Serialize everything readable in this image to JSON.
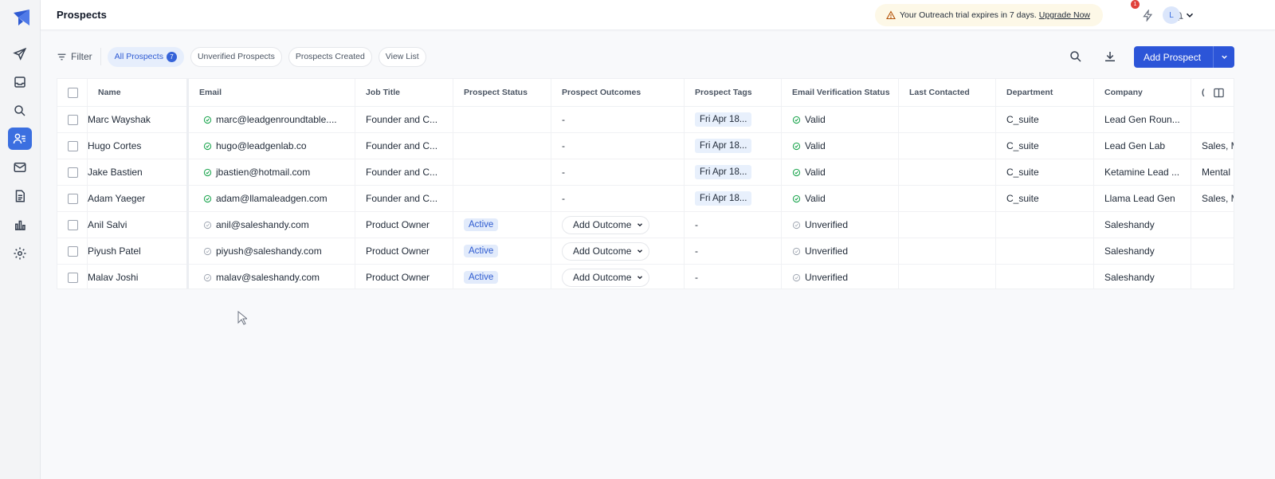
{
  "app": {
    "page_title": "Prospects"
  },
  "trial_banner": {
    "text": "Your Outreach trial expires in 7 days.",
    "link": "Upgrade Now"
  },
  "header": {
    "notification_count": "1",
    "avatar_initial": "L"
  },
  "filter_bar": {
    "filter_label": "Filter",
    "chips": [
      {
        "label": "All Prospects",
        "count": "7",
        "active": true
      },
      {
        "label": "Unverified Prospects"
      },
      {
        "label": "Prospects Created"
      },
      {
        "label": "View List"
      }
    ]
  },
  "actions": {
    "add_prospect_label": "Add Prospect"
  },
  "table": {
    "columns": [
      "Name",
      "Email",
      "Job Title",
      "Prospect Status",
      "Prospect Outcomes",
      "Prospect Tags",
      "Email Verification Status",
      "Last Contacted",
      "Department",
      "Company",
      "("
    ],
    "rows": [
      {
        "name": "Marc Wayshak",
        "email": "marc@leadgenroundtable....",
        "email_verified": true,
        "job_title": "Founder and C...",
        "status": "",
        "outcome": "-",
        "outcome_dropdown": false,
        "tags": "Fri Apr 18...",
        "verification": "Valid",
        "last_contacted": "",
        "department": "C_suite",
        "company": "Lead Gen Roun...",
        "extra": ""
      },
      {
        "name": "Hugo Cortes",
        "email": "hugo@leadgenlab.co",
        "email_verified": true,
        "job_title": "Founder and C...",
        "status": "",
        "outcome": "-",
        "outcome_dropdown": false,
        "tags": "Fri Apr 18...",
        "verification": "Valid",
        "last_contacted": "",
        "department": "C_suite",
        "company": "Lead Gen Lab",
        "extra": "Sales, M"
      },
      {
        "name": "Jake Bastien",
        "email": "jbastien@hotmail.com",
        "email_verified": true,
        "job_title": "Founder and C...",
        "status": "",
        "outcome": "-",
        "outcome_dropdown": false,
        "tags": "Fri Apr 18...",
        "verification": "Valid",
        "last_contacted": "",
        "department": "C_suite",
        "company": "Ketamine Lead ...",
        "extra": "Mental"
      },
      {
        "name": "Adam Yaeger",
        "email": "adam@llamaleadgen.com",
        "email_verified": true,
        "job_title": "Founder and C...",
        "status": "",
        "outcome": "-",
        "outcome_dropdown": false,
        "tags": "Fri Apr 18...",
        "verification": "Valid",
        "last_contacted": "",
        "department": "C_suite",
        "company": "Llama Lead Gen",
        "extra": "Sales, M"
      },
      {
        "name": "Anil Salvi",
        "email": "anil@saleshandy.com",
        "email_verified": false,
        "job_title": "Product Owner",
        "status": "Active",
        "outcome": "Add Outcome",
        "outcome_dropdown": true,
        "tags": "-",
        "verification": "Unverified",
        "last_contacted": "",
        "department": "",
        "company": "Saleshandy",
        "extra": ""
      },
      {
        "name": "Piyush Patel",
        "email": "piyush@saleshandy.com",
        "email_verified": false,
        "job_title": "Product Owner",
        "status": "Active",
        "outcome": "Add Outcome",
        "outcome_dropdown": true,
        "tags": "-",
        "verification": "Unverified",
        "last_contacted": "",
        "department": "",
        "company": "Saleshandy",
        "extra": ""
      },
      {
        "name": "Malav Joshi",
        "email": "malav@saleshandy.com",
        "email_verified": false,
        "job_title": "Product Owner",
        "status": "Active",
        "outcome": "Add Outcome",
        "outcome_dropdown": true,
        "tags": "-",
        "verification": "Unverified",
        "last_contacted": "",
        "department": "",
        "company": "Saleshandy",
        "extra": ""
      }
    ]
  },
  "colors": {
    "accent": "#2c55d8",
    "valid": "#16a34a",
    "unverified": "#9ca3af"
  }
}
